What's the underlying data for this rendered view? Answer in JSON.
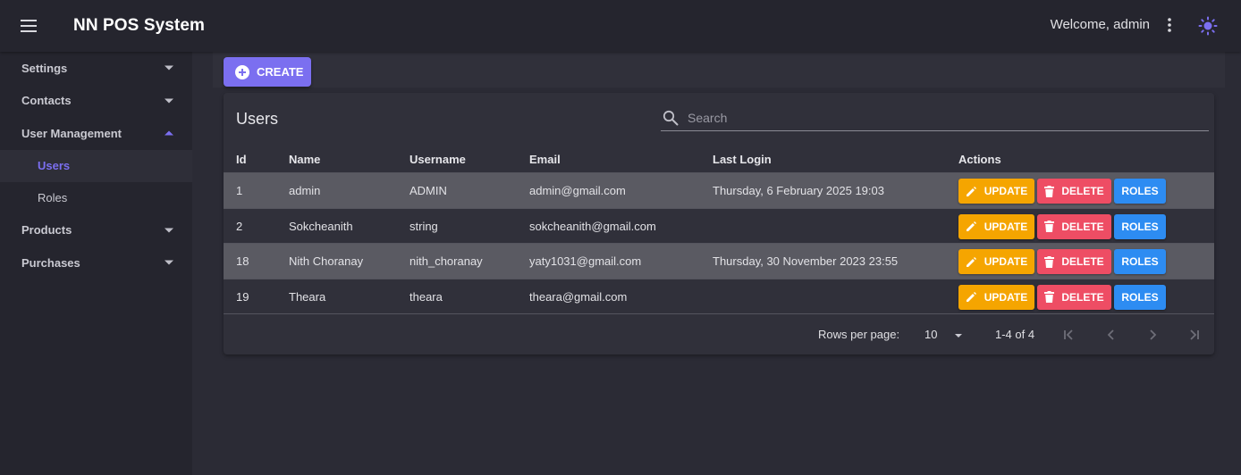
{
  "app": {
    "title": "NN POS System",
    "welcome": "Welcome, admin"
  },
  "colors": {
    "primary": "#7b6ff0",
    "update": "#f5a500",
    "delete": "#ee4d64",
    "roles": "#2d8cf2"
  },
  "sidebar": {
    "items": [
      {
        "label": "Settings",
        "icon": "chevron-down-icon"
      },
      {
        "label": "Contacts",
        "icon": "chevron-down-icon"
      },
      {
        "label": "User Management",
        "icon": "chevron-up-icon",
        "expanded": true,
        "children": [
          {
            "label": "Users",
            "active": true
          },
          {
            "label": "Roles"
          }
        ]
      },
      {
        "label": "Products",
        "icon": "chevron-down-icon"
      },
      {
        "label": "Purchases",
        "icon": "chevron-down-icon"
      }
    ]
  },
  "toolbar": {
    "create_label": "CREATE"
  },
  "users_card": {
    "title": "Users",
    "search_placeholder": "Search",
    "columns": [
      "Id",
      "Name",
      "Username",
      "Email",
      "Last Login",
      "Actions"
    ],
    "rows": [
      {
        "id": "1",
        "name": "admin",
        "username": "ADMIN",
        "email": "admin@gmail.com",
        "last_login": "Thursday, 6 February 2025 19:03"
      },
      {
        "id": "2",
        "name": "Sokcheanith",
        "username": "string",
        "email": "sokcheanith@gmail.com",
        "last_login": ""
      },
      {
        "id": "18",
        "name": "Nith Choranay",
        "username": "nith_choranay",
        "email": "yaty1031@gmail.com",
        "last_login": "Thursday, 30 November 2023 23:55"
      },
      {
        "id": "19",
        "name": "Theara",
        "username": "theara",
        "email": "theara@gmail.com",
        "last_login": ""
      }
    ],
    "actions": {
      "update_label": "UPDATE",
      "delete_label": "DELETE",
      "roles_label": "ROLES"
    },
    "pagination": {
      "rows_per_page_label": "Rows per page:",
      "rows_per_page": "10",
      "range": "1-4 of 4"
    }
  }
}
